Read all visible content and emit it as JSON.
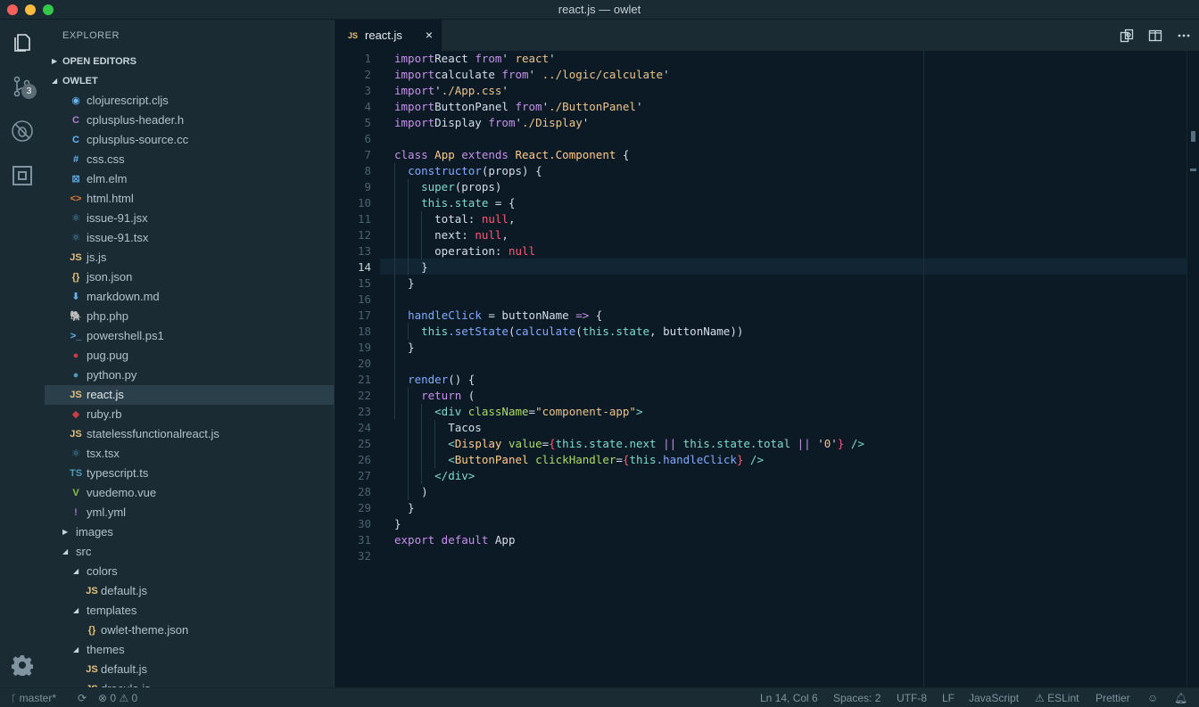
{
  "window": {
    "title": "react.js — owlet"
  },
  "activity_bar": {
    "scm_badge": "3"
  },
  "sidebar": {
    "title": "EXPLORER",
    "open_editors": "OPEN EDITORS",
    "project": "OWLET",
    "files": [
      {
        "icon": "clojure-file-icon",
        "glyph": "◉",
        "color": "#64b5f6",
        "label": "clojurescript.cljs"
      },
      {
        "icon": "cpp-header-icon",
        "glyph": "C",
        "color": "#b07cd8",
        "label": "cplusplus-header.h"
      },
      {
        "icon": "cpp-source-icon",
        "glyph": "C",
        "color": "#64b5f6",
        "label": "cplusplus-source.cc"
      },
      {
        "icon": "css-file-icon",
        "glyph": "#",
        "color": "#64b5f6",
        "label": "css.css"
      },
      {
        "icon": "elm-file-icon",
        "glyph": "⊠",
        "color": "#64b5f6",
        "label": "elm.elm"
      },
      {
        "icon": "html-file-icon",
        "glyph": "<>",
        "color": "#e37933",
        "label": "html.html"
      },
      {
        "icon": "react-file-icon",
        "glyph": "⚛",
        "color": "#519aba",
        "label": "issue-91.jsx"
      },
      {
        "icon": "react-ts-file-icon",
        "glyph": "⚛",
        "color": "#519aba",
        "label": "issue-91.tsx"
      },
      {
        "icon": "js-file-icon",
        "glyph": "JS",
        "color": "#e5c07b",
        "label": "js.js"
      },
      {
        "icon": "json-file-icon",
        "glyph": "{}",
        "color": "#e5c07b",
        "label": "json.json"
      },
      {
        "icon": "markdown-file-icon",
        "glyph": "⬇",
        "color": "#64b5f6",
        "label": "markdown.md"
      },
      {
        "icon": "php-file-icon",
        "glyph": "🐘",
        "color": "#a074c4",
        "label": "php.php"
      },
      {
        "icon": "powershell-file-icon",
        "glyph": ">_",
        "color": "#64b5f6",
        "label": "powershell.ps1"
      },
      {
        "icon": "pug-file-icon",
        "glyph": "●",
        "color": "#cc3e44",
        "label": "pug.pug"
      },
      {
        "icon": "python-file-icon",
        "glyph": "●",
        "color": "#519aba",
        "label": "python.py"
      },
      {
        "icon": "js-file-icon",
        "glyph": "JS",
        "color": "#e5c07b",
        "label": "react.js",
        "active": true
      },
      {
        "icon": "ruby-file-icon",
        "glyph": "◆",
        "color": "#cc3e44",
        "label": "ruby.rb"
      },
      {
        "icon": "js-file-icon",
        "glyph": "JS",
        "color": "#e5c07b",
        "label": "statelessfunctionalreact.js"
      },
      {
        "icon": "react-ts-file-icon",
        "glyph": "⚛",
        "color": "#519aba",
        "label": "tsx.tsx"
      },
      {
        "icon": "ts-file-icon",
        "glyph": "TS",
        "color": "#519aba",
        "label": "typescript.ts"
      },
      {
        "icon": "vue-file-icon",
        "glyph": "V",
        "color": "#8dc149",
        "label": "vuedemo.vue"
      },
      {
        "icon": "yaml-file-icon",
        "glyph": "!",
        "color": "#a074c4",
        "label": "yml.yml"
      }
    ],
    "folders": [
      {
        "type": "folder",
        "label": "images",
        "level": 0,
        "open": false
      },
      {
        "type": "folder",
        "label": "src",
        "level": 0,
        "open": true
      },
      {
        "type": "folder",
        "label": "colors",
        "level": 1,
        "open": true
      },
      {
        "type": "file",
        "icon": "js-file-icon",
        "glyph": "JS",
        "color": "#e5c07b",
        "label": "default.js",
        "level": 2
      },
      {
        "type": "folder",
        "label": "templates",
        "level": 1,
        "open": true
      },
      {
        "type": "file",
        "icon": "json-file-icon",
        "glyph": "{}",
        "color": "#e5c07b",
        "label": "owlet-theme.json",
        "level": 2
      },
      {
        "type": "folder",
        "label": "themes",
        "level": 1,
        "open": true
      },
      {
        "type": "file",
        "icon": "js-file-icon",
        "glyph": "JS",
        "color": "#e5c07b",
        "label": "default.js",
        "level": 2
      },
      {
        "type": "file",
        "icon": "js-file-icon",
        "glyph": "JS",
        "color": "#e5c07b",
        "label": "dracula.js",
        "level": 2
      }
    ]
  },
  "tab": {
    "icon_text": "JS",
    "label": "react.js",
    "close": "×"
  },
  "editor": {
    "current_line": 14,
    "lines": [
      [
        [
          "kw",
          "import"
        ],
        [
          "",
          "React "
        ],
        [
          "kw",
          "from"
        ],
        [
          "",
          "' "
        ],
        [
          "str",
          "react"
        ],
        [
          "",
          "'"
        ]
      ],
      [
        [
          "kw",
          "import"
        ],
        [
          "",
          "calculate "
        ],
        [
          "kw",
          "from"
        ],
        [
          "",
          "' "
        ],
        [
          "str",
          "../logic/calculate"
        ],
        [
          "",
          "'"
        ]
      ],
      [
        [
          "kw",
          "import"
        ],
        [
          "",
          "'"
        ],
        [
          "str",
          "./App.css"
        ],
        [
          "",
          "'"
        ]
      ],
      [
        [
          "kw",
          "import"
        ],
        [
          "",
          "ButtonPanel "
        ],
        [
          "kw",
          "from"
        ],
        [
          "",
          "'"
        ],
        [
          "str",
          "./ButtonPanel"
        ],
        [
          "",
          "'"
        ]
      ],
      [
        [
          "kw",
          "import"
        ],
        [
          "",
          "Display "
        ],
        [
          "kw",
          "from"
        ],
        [
          "",
          "'"
        ],
        [
          "str",
          "./Display"
        ],
        [
          "",
          "'"
        ]
      ],
      [],
      [
        [
          "kw",
          "class"
        ],
        [
          "cls",
          " App"
        ],
        [
          "kw",
          " extends"
        ],
        [
          "cls",
          " React.Component"
        ],
        [
          "",
          " {"
        ]
      ],
      [
        [
          "",
          "  "
        ],
        [
          "fn",
          "constructor"
        ],
        [
          "",
          "(props) {"
        ]
      ],
      [
        [
          "",
          "    "
        ],
        [
          "this",
          "super"
        ],
        [
          "",
          "(props)"
        ]
      ],
      [
        [
          "",
          "    "
        ],
        [
          "this",
          "this"
        ],
        [
          "this",
          ".state"
        ],
        [
          "",
          " = {"
        ]
      ],
      [
        [
          "",
          "      total: "
        ],
        [
          "nul",
          "null"
        ],
        [
          "",
          ","
        ]
      ],
      [
        [
          "",
          "      next: "
        ],
        [
          "nul",
          "null"
        ],
        [
          "",
          ","
        ]
      ],
      [
        [
          "",
          "      operation: "
        ],
        [
          "nul",
          "null"
        ]
      ],
      [
        [
          "",
          "    }"
        ]
      ],
      [
        [
          "",
          "  }"
        ]
      ],
      [],
      [
        [
          "",
          "  "
        ],
        [
          "fn",
          "handleClick"
        ],
        [
          "",
          " = buttonName "
        ],
        [
          "op",
          "=>"
        ],
        [
          "",
          " {"
        ]
      ],
      [
        [
          "",
          "    "
        ],
        [
          "this",
          "this"
        ],
        [
          "fn",
          ".setState"
        ],
        [
          "",
          "("
        ],
        [
          "fn",
          "calculate"
        ],
        [
          "",
          "("
        ],
        [
          "this",
          "this"
        ],
        [
          "this",
          ".state"
        ],
        [
          "",
          ", buttonName))"
        ]
      ],
      [
        [
          "",
          "  }"
        ]
      ],
      [],
      [
        [
          "",
          "  "
        ],
        [
          "fn",
          "render"
        ],
        [
          "",
          "() {"
        ]
      ],
      [
        [
          "",
          "    "
        ],
        [
          "kw",
          "return"
        ],
        [
          "",
          " ("
        ]
      ],
      [
        [
          "",
          "      "
        ],
        [
          "tag",
          "<div"
        ],
        [
          "attr",
          " className"
        ],
        [
          "",
          "="
        ],
        [
          "str",
          "\"component-app\""
        ],
        [
          "tag",
          ">"
        ]
      ],
      [
        [
          "",
          "        Tacos"
        ]
      ],
      [
        [
          "",
          "        "
        ],
        [
          "tag",
          "<"
        ],
        [
          "tagc",
          "Display"
        ],
        [
          "attr",
          " value"
        ],
        [
          "",
          "="
        ],
        [
          "jsxb",
          "{"
        ],
        [
          "this",
          "this"
        ],
        [
          "this",
          ".state.next"
        ],
        [
          "op",
          " || "
        ],
        [
          "this",
          "this"
        ],
        [
          "this",
          ".state.total"
        ],
        [
          "op",
          " || "
        ],
        [
          "",
          "'"
        ],
        [
          "str",
          "0"
        ],
        [
          "",
          "'"
        ],
        [
          "jsxb",
          "}"
        ],
        [
          "tag",
          " />"
        ]
      ],
      [
        [
          "",
          "        "
        ],
        [
          "tag",
          "<"
        ],
        [
          "tagc",
          "ButtonPanel"
        ],
        [
          "attr",
          " clickHandler"
        ],
        [
          "",
          "="
        ],
        [
          "jsxb",
          "{"
        ],
        [
          "this",
          "this"
        ],
        [
          "fn",
          ".handleClick"
        ],
        [
          "jsxb",
          "}"
        ],
        [
          "tag",
          " />"
        ]
      ],
      [
        [
          "",
          "      "
        ],
        [
          "tag",
          "</div>"
        ]
      ],
      [
        [
          "",
          "    )"
        ]
      ],
      [
        [
          "",
          "  }"
        ]
      ],
      [
        [
          "",
          "}"
        ]
      ],
      [
        [
          "kw",
          "export"
        ],
        [
          "kw",
          " default"
        ],
        [
          "",
          " App"
        ]
      ],
      []
    ]
  },
  "statusbar": {
    "branch": "master*",
    "errors": "0",
    "warnings": "0",
    "position": "Ln 14, Col 6",
    "spaces": "Spaces: 2",
    "encoding": "UTF-8",
    "eol": "LF",
    "language": "JavaScript",
    "eslint": "ESLint",
    "prettier": "Prettier"
  }
}
